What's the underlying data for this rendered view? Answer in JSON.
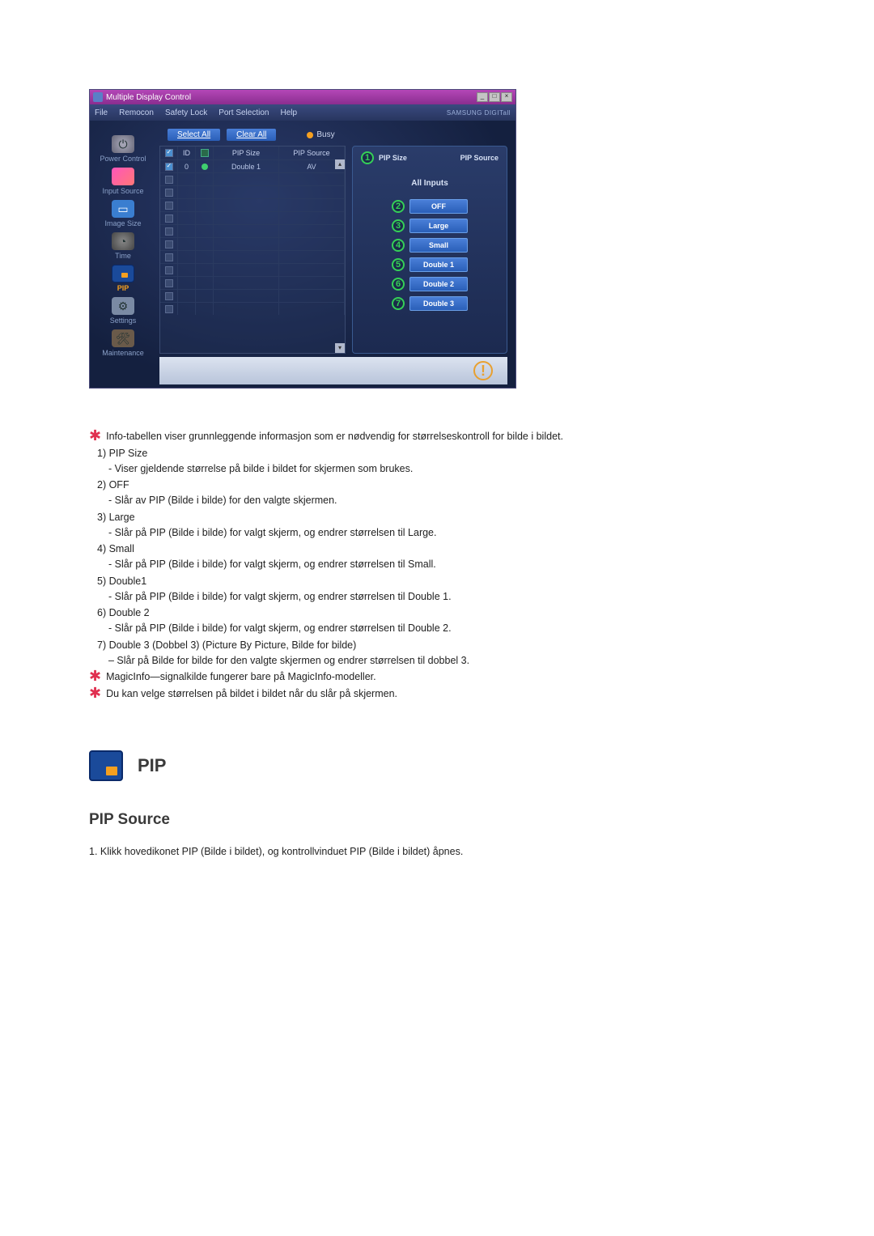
{
  "window": {
    "title": "Multiple Display Control",
    "brand": "SAMSUNG DIGITall"
  },
  "menu": {
    "items": [
      "File",
      "Remocon",
      "Safety Lock",
      "Port Selection",
      "Help"
    ]
  },
  "sidebar": {
    "items": [
      {
        "label": "Power Control"
      },
      {
        "label": "Input Source"
      },
      {
        "label": "Image Size"
      },
      {
        "label": "Time"
      },
      {
        "label": "PIP",
        "active": true
      },
      {
        "label": "Settings"
      },
      {
        "label": "Maintenance"
      }
    ]
  },
  "toolbar": {
    "select_all": "Select All",
    "clear_all": "Clear All",
    "busy": "Busy"
  },
  "table": {
    "headers": {
      "chk": "☑",
      "id": "ID",
      "status": "",
      "pip_size": "PIP Size",
      "pip_source": "PIP Source"
    },
    "rows": [
      {
        "checked": true,
        "id": "0",
        "status": "green",
        "size": "Double 1",
        "src": "AV"
      },
      {
        "checked": false,
        "id": "",
        "status": "",
        "size": "",
        "src": ""
      },
      {
        "checked": false,
        "id": "",
        "status": "",
        "size": "",
        "src": ""
      },
      {
        "checked": false,
        "id": "",
        "status": "",
        "size": "",
        "src": ""
      },
      {
        "checked": false,
        "id": "",
        "status": "",
        "size": "",
        "src": ""
      },
      {
        "checked": false,
        "id": "",
        "status": "",
        "size": "",
        "src": ""
      },
      {
        "checked": false,
        "id": "",
        "status": "",
        "size": "",
        "src": ""
      },
      {
        "checked": false,
        "id": "",
        "status": "",
        "size": "",
        "src": ""
      },
      {
        "checked": false,
        "id": "",
        "status": "",
        "size": "",
        "src": ""
      },
      {
        "checked": false,
        "id": "",
        "status": "",
        "size": "",
        "src": ""
      },
      {
        "checked": false,
        "id": "",
        "status": "",
        "size": "",
        "src": ""
      },
      {
        "checked": false,
        "id": "",
        "status": "",
        "size": "",
        "src": ""
      }
    ]
  },
  "panel": {
    "pip_size_label": "PIP Size",
    "pip_source_label": "PIP Source",
    "subtitle": "All Inputs",
    "options": [
      {
        "num": "2",
        "label": "OFF"
      },
      {
        "num": "3",
        "label": "Large"
      },
      {
        "num": "4",
        "label": "Small"
      },
      {
        "num": "5",
        "label": "Double 1"
      },
      {
        "num": "6",
        "label": "Double 2"
      },
      {
        "num": "7",
        "label": "Double 3"
      }
    ],
    "callout1": "1"
  },
  "text": {
    "intro": "Info-tabellen viser grunnleggende informasjon som er nødvendig for størrelseskontroll for bilde i bildet.",
    "items": [
      {
        "num": "1)",
        "title": "PIP Size",
        "desc": "- Viser gjeldende størrelse på bilde i bildet for skjermen som brukes."
      },
      {
        "num": "2)",
        "title": "OFF",
        "desc": "- Slår av PIP (Bilde i bilde) for den valgte skjermen."
      },
      {
        "num": "3)",
        "title": "Large",
        "desc": "- Slår på PIP (Bilde i bilde) for valgt skjerm, og endrer størrelsen til Large."
      },
      {
        "num": "4)",
        "title": "Small",
        "desc": "- Slår på PIP (Bilde i bilde) for valgt skjerm, og endrer størrelsen til Small."
      },
      {
        "num": "5)",
        "title": "Double1",
        "desc": "- Slår på PIP (Bilde i bilde) for valgt skjerm, og endrer størrelsen til Double 1."
      },
      {
        "num": "6)",
        "title": "Double 2",
        "desc": "- Slår på PIP (Bilde i bilde) for valgt skjerm, og endrer størrelsen til Double 2."
      },
      {
        "num": "7)",
        "title": "Double 3 (Dobbel 3) (Picture By Picture, Bilde for bilde)",
        "desc": "– Slår på Bilde for bilde for den valgte skjermen og endrer størrelsen til dobbel 3."
      }
    ],
    "note1": "MagicInfo—signalkilde fungerer bare på MagicInfo-modeller.",
    "note2": "Du kan velge størrelsen på bildet i bildet når du slår på skjermen.",
    "section_title": "PIP",
    "sub_section": "PIP Source",
    "foot": "1.  Klikk hovedikonet PIP (Bilde i bildet), og kontrollvinduet PIP (Bilde i bildet) åpnes."
  }
}
